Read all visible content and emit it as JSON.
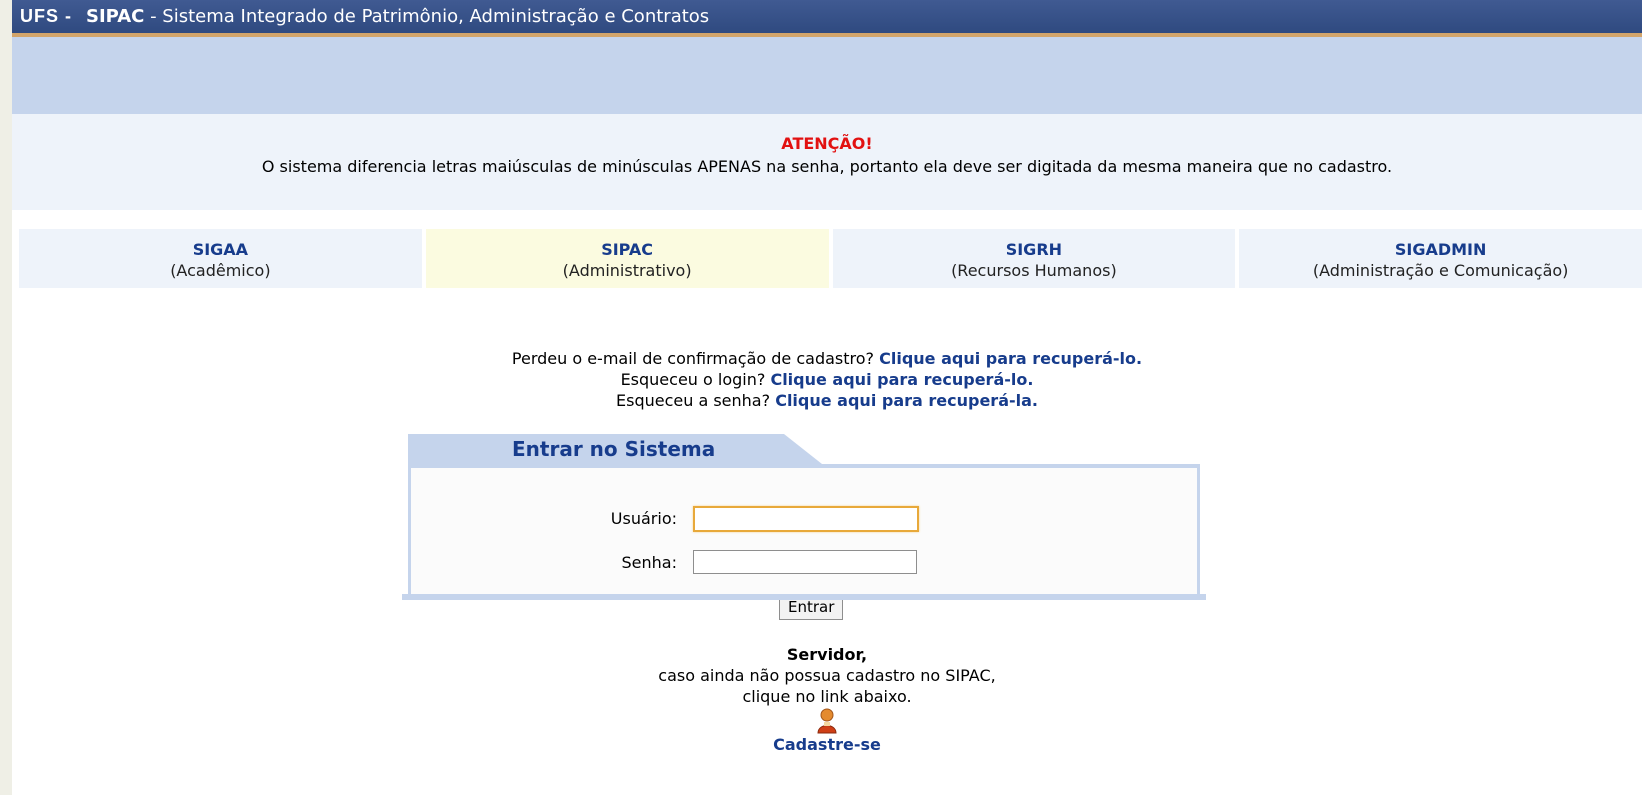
{
  "header": {
    "org": "UFS -",
    "system": "SIPAC",
    "subtitle": "- Sistema Integrado de Patrimônio, Administração e Contratos"
  },
  "warning": {
    "title": "ATENÇÃO!",
    "message": "O sistema diferencia letras maiúsculas de minúsculas APENAS na senha, portanto ela deve ser digitada da mesma maneira que no cadastro."
  },
  "systems": [
    {
      "name": "SIGAA",
      "desc": "(Acadêmico)"
    },
    {
      "name": "SIPAC",
      "desc": "(Administrativo)"
    },
    {
      "name": "SIGRH",
      "desc": "(Recursos Humanos)"
    },
    {
      "name": "SIGADMIN",
      "desc": "(Administração e Comunicação)"
    }
  ],
  "recover": {
    "email_q": "Perdeu o e-mail de confirmação de cadastro?",
    "email_link": "Clique aqui para recuperá-lo.",
    "login_q": "Esqueceu o login?",
    "login_link": "Clique aqui para recuperá-lo.",
    "senha_q": "Esqueceu a senha?",
    "senha_link": "Clique aqui para recuperá-la."
  },
  "login": {
    "title": "Entrar no Sistema",
    "user_label": "Usuário:",
    "user_value": "",
    "pass_label": "Senha:",
    "pass_value": "",
    "submit": "Entrar"
  },
  "servidor": {
    "title": "Servidor,",
    "line1": "caso ainda não possua cadastro no SIPAC,",
    "line2": "clique no link abaixo.",
    "icon": "user-icon",
    "link": "Cadastre-se"
  },
  "colors": {
    "header_bg": "#2f4a80",
    "band": "#c5d4ec",
    "warning_title": "#e21111",
    "link": "#173c8c",
    "active_system": "#fbfbe0"
  }
}
